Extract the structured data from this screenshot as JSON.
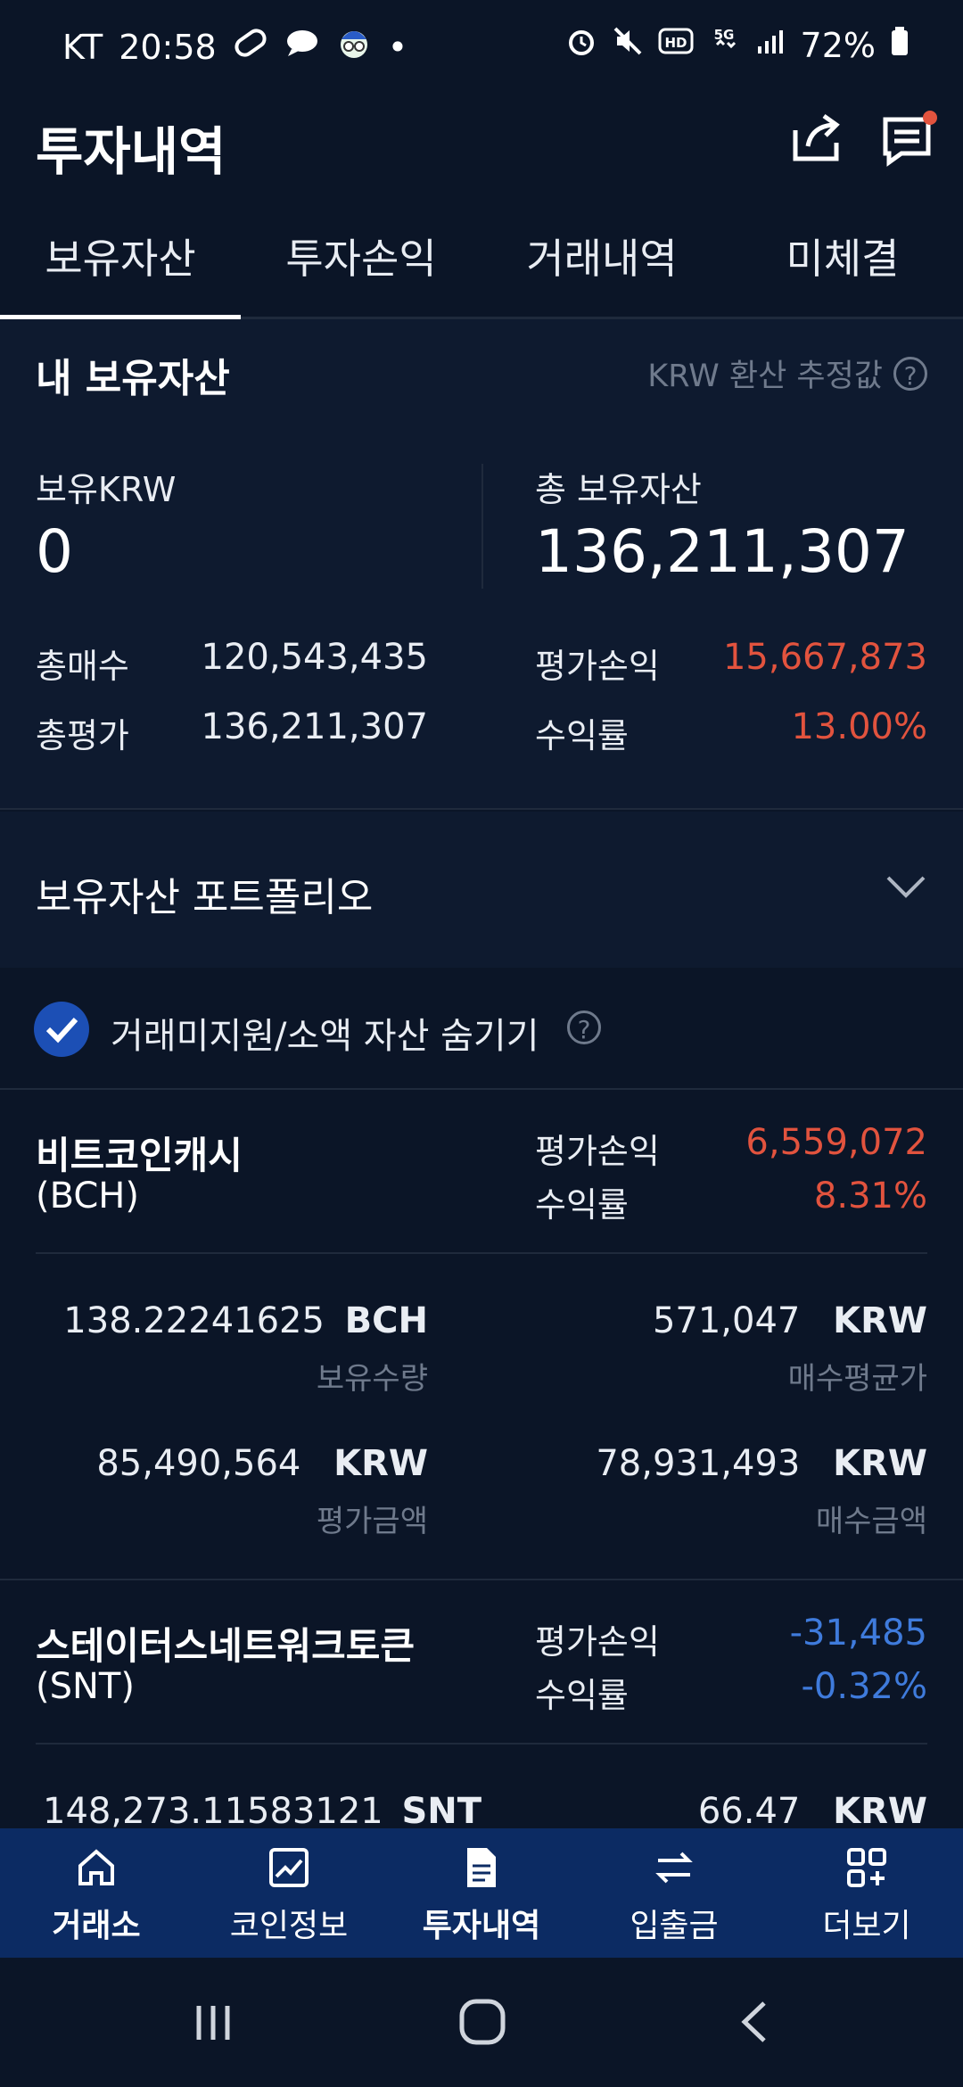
{
  "status_bar": {
    "carrier": "KT",
    "time": "20:58",
    "dot": "•",
    "battery": "72%"
  },
  "header": {
    "title": "투자내역"
  },
  "tabs": [
    {
      "label": "보유자산"
    },
    {
      "label": "투자손익"
    },
    {
      "label": "거래내역"
    },
    {
      "label": "미체결"
    }
  ],
  "holdings": {
    "title": "내 보유자산",
    "note": "KRW 환산 추정값",
    "krw_label": "보유KRW",
    "krw_value": "0",
    "total_label": "총 보유자산",
    "total_value": "136,211,307",
    "buy_label": "총매수",
    "buy_value": "120,543,435",
    "eval_label": "총평가",
    "eval_value": "136,211,307",
    "pnl_label": "평가손익",
    "pnl_value": "15,667,873",
    "rate_label": "수익률",
    "rate_value": "13.00%"
  },
  "portfolio": {
    "title": "보유자산 포트폴리오"
  },
  "filter": {
    "label": "거래미지원/소액 자산 숨기기"
  },
  "assets": [
    {
      "name": "비트코인캐시",
      "symbol": "(BCH)",
      "pnl_label": "평가손익",
      "pnl_value": "6,559,072",
      "rate_label": "수익률",
      "rate_value": "8.31%",
      "qty_value": "138.22241625",
      "qty_unit": "BCH",
      "qty_label": "보유수량",
      "avg_value": "571,047",
      "avg_unit": "KRW",
      "avg_label": "매수평균가",
      "eval_value": "85,490,564",
      "eval_unit": "KRW",
      "eval_label": "평가금액",
      "buy_value": "78,931,493",
      "buy_unit": "KRW",
      "buy_label": "매수금액"
    },
    {
      "name": "스테이터스네트워크토큰",
      "symbol": "(SNT)",
      "pnl_label": "평가손익",
      "pnl_value": "-31,485",
      "rate_label": "수익률",
      "rate_value": "-0.32%",
      "qty_value": "148,273.11583121",
      "qty_unit": "SNT",
      "avg_value": "66.47",
      "avg_unit": "KRW"
    }
  ],
  "bottom_nav": [
    {
      "label": "거래소",
      "icon": "home-icon"
    },
    {
      "label": "코인정보",
      "icon": "chart-icon"
    },
    {
      "label": "투자내역",
      "icon": "document-icon"
    },
    {
      "label": "입출금",
      "icon": "transfer-icon"
    },
    {
      "label": "더보기",
      "icon": "grid-plus-icon"
    }
  ]
}
